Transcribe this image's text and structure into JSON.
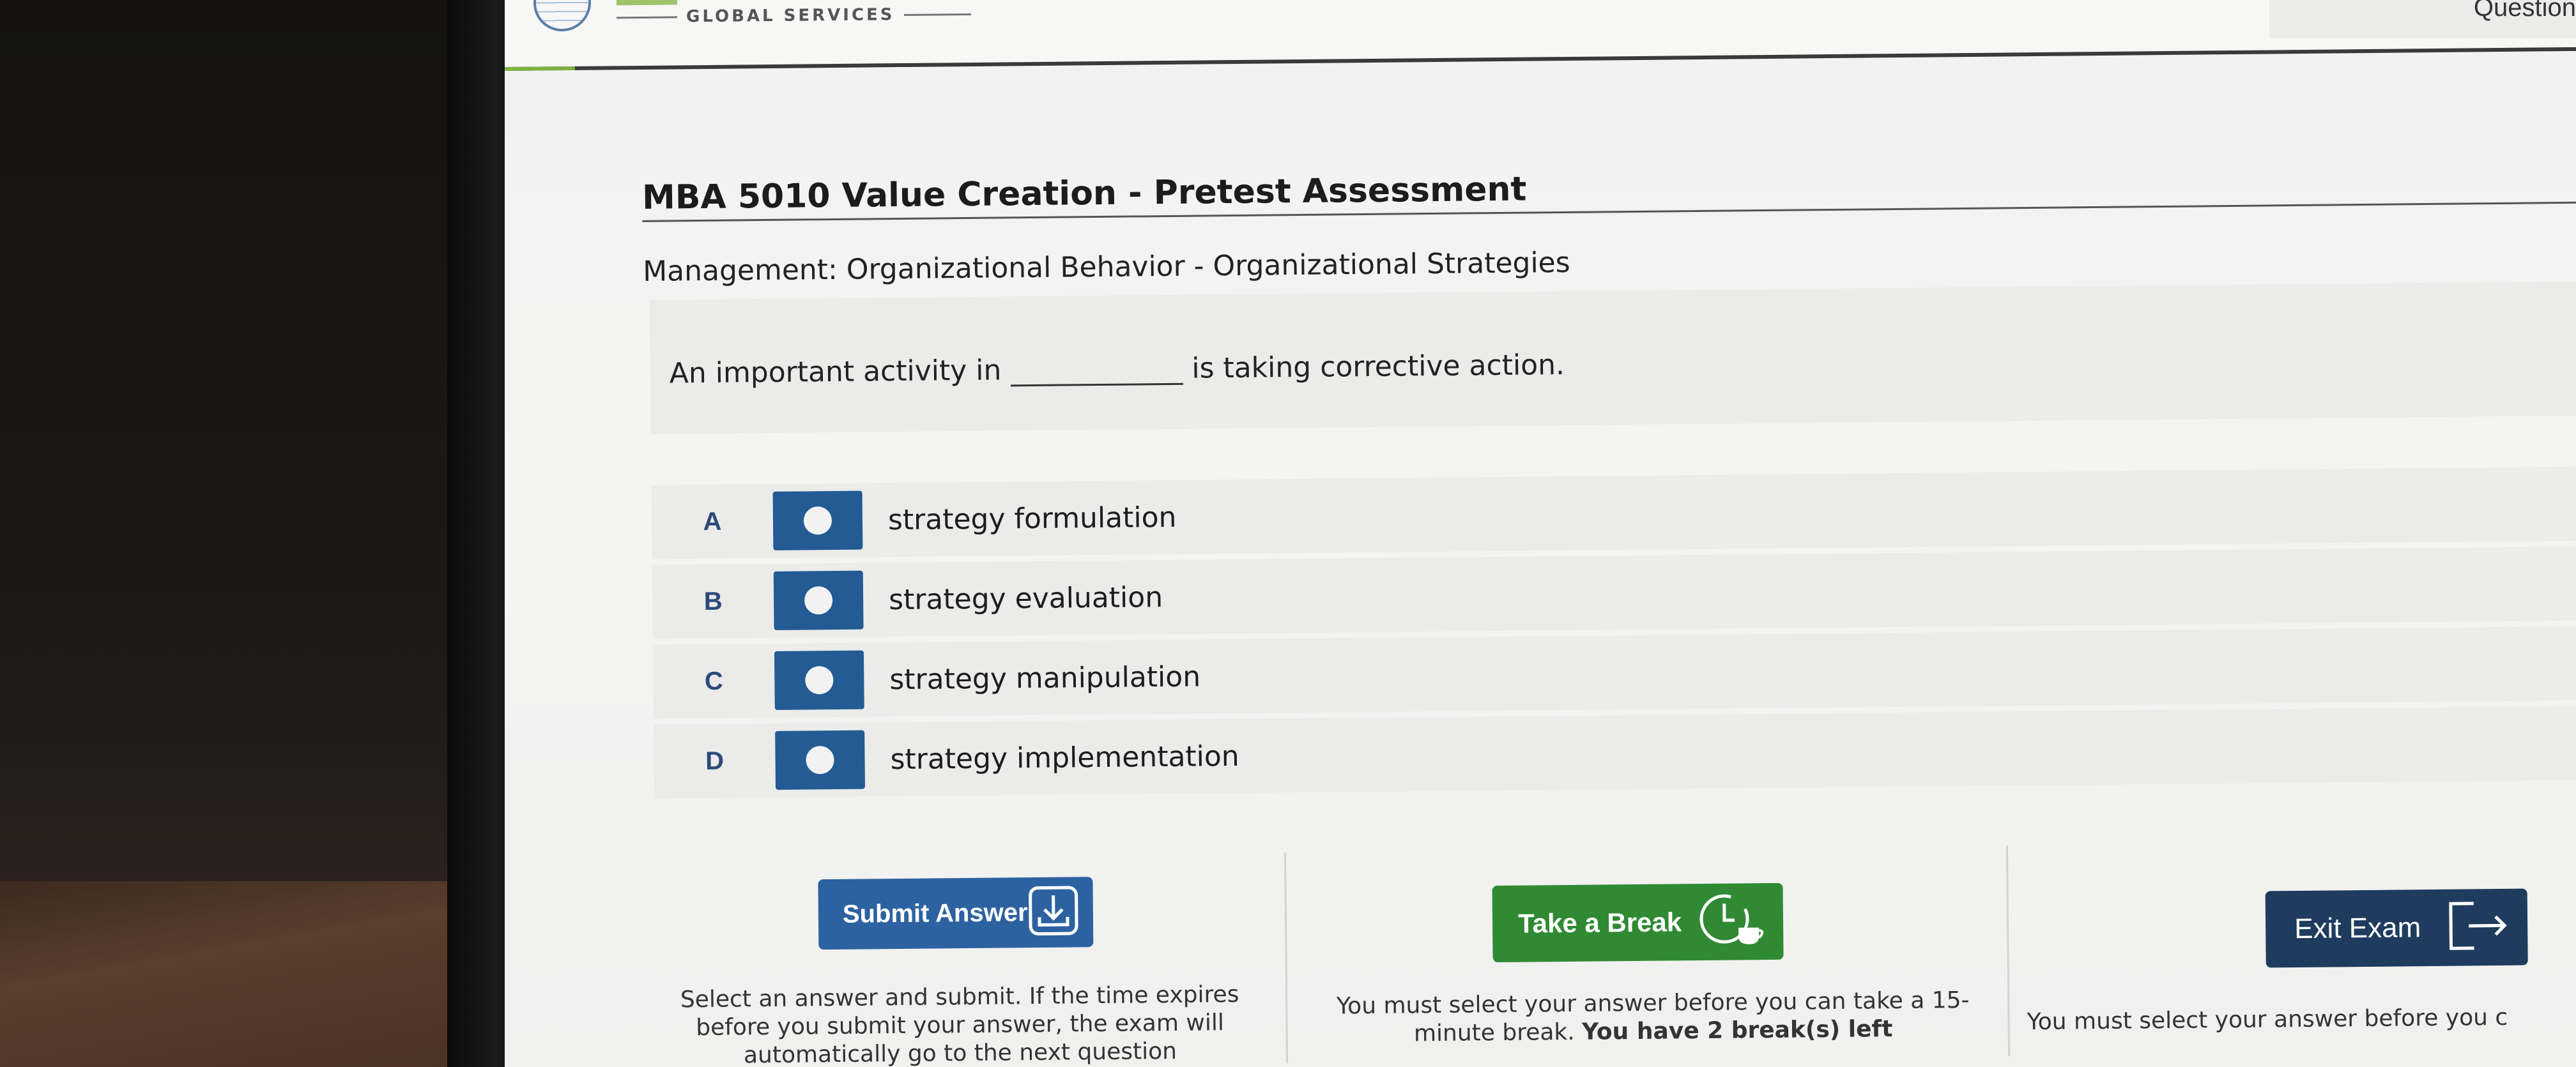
{
  "header": {
    "brand": "GLOBAL SERVICES",
    "question_label": "Question"
  },
  "exam": {
    "title": "MBA 5010 Value Creation - Pretest Assessment",
    "subtitle": "Management: Organizational Behavior - Organizational Strategies"
  },
  "question": {
    "before_blank": "An important activity in",
    "after_blank": "is taking corrective action."
  },
  "options": [
    {
      "letter": "A",
      "text": "strategy formulation"
    },
    {
      "letter": "B",
      "text": "strategy evaluation"
    },
    {
      "letter": "C",
      "text": "strategy manipulation"
    },
    {
      "letter": "D",
      "text": "strategy implementation"
    }
  ],
  "actions": {
    "submit_label": "Submit Answer",
    "break_label": "Take a Break",
    "exit_label": "Exit Exam"
  },
  "help": {
    "submit": "Select an answer and submit. If the time expires before you submit your answer, the exam will automatically go to the next question",
    "break_text": "You must select your answer before you can take a 15-minute break.",
    "break_strong": "You have 2 break(s) left",
    "exit": "You must select your answer before you c"
  },
  "colors": {
    "primary_blue": "#2d62a1",
    "radio_blue": "#235b94",
    "break_green": "#2f8a33",
    "exit_navy": "#1f3c5e",
    "letter_blue": "#2b4a78"
  },
  "icons": {
    "submit": "download-arrow-icon",
    "break": "clock-coffee-icon",
    "exit": "exit-door-icon"
  }
}
